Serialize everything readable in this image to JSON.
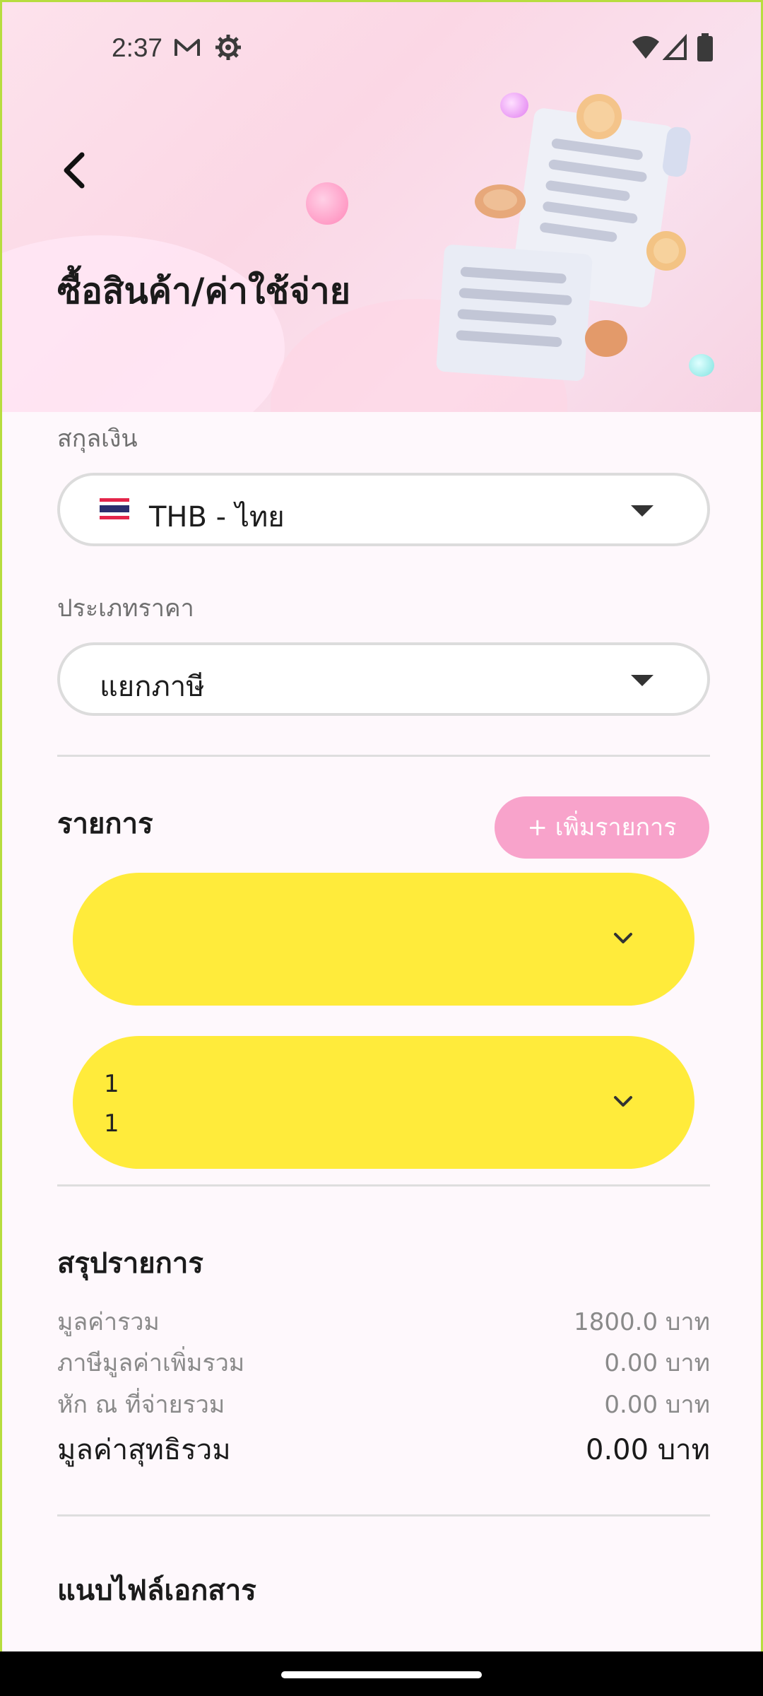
{
  "status_bar": {
    "time": "2:37",
    "icons": [
      "gmail-icon",
      "settings-icon",
      "wifi-icon",
      "signal-icon",
      "battery-icon"
    ]
  },
  "header": {
    "title": "ซื้อสินค้า/ค่าใช้จ่าย",
    "back_icon": "chevron-left-icon"
  },
  "form": {
    "currency": {
      "label": "สกุลเงิน",
      "value": "THB - ไทย",
      "flag": "thailand-flag-icon"
    },
    "price_type": {
      "label": "ประเภทราคา",
      "value": "แยกภาษี"
    }
  },
  "items": {
    "title": "รายการ",
    "add_label": "+ เพิ่มรายการ",
    "cards": [
      {
        "line1": "",
        "line2": ""
      },
      {
        "line1": "1",
        "line2": "1"
      }
    ]
  },
  "summary": {
    "title": "สรุปรายการ",
    "rows": [
      {
        "key": "มูลค่ารวม",
        "value": "1800.0 บาท"
      },
      {
        "key": "ภาษีมูลค่าเพิ่มรวม",
        "value": "0.00 บาท"
      },
      {
        "key": "หัก ณ ที่จ่ายรวม",
        "value": "0.00 บาท"
      }
    ],
    "total": {
      "key": "มูลค่าสุทธิรวม",
      "value": "0.00 บาท"
    }
  },
  "attachments": {
    "title": "แนบไฟล์เอกสาร"
  },
  "colors": {
    "accent_pink": "#f8a3cb",
    "card_yellow": "#ffeb3b",
    "frame_green": "#b7dd3f"
  }
}
